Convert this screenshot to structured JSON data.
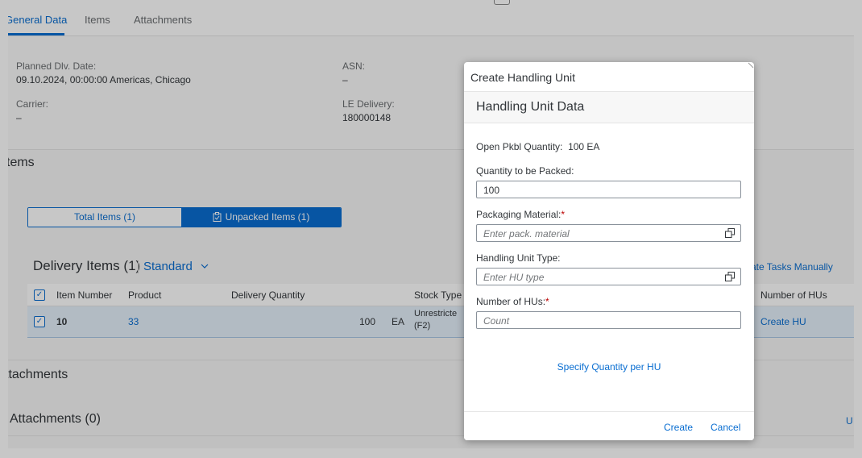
{
  "tabs": [
    "General Data",
    "Items",
    "Attachments"
  ],
  "general": {
    "planned_label": "Planned Dlv. Date:",
    "planned_value": "09.10.2024, 00:00:00 Americas, Chicago",
    "asn_label": "ASN:",
    "asn_value": "–",
    "carrier_label": "Carrier:",
    "carrier_value": "–",
    "le_label": "LE Delivery:",
    "le_value": "180000148"
  },
  "items_section": {
    "title": "tems",
    "seg_total": "Total Items (1)",
    "seg_unpacked": "Unpacked Items (1)",
    "table_title": "Delivery Items (1)",
    "variant": "Standard",
    "create_tasks": "ate Tasks Manually",
    "columns": [
      "Item Number",
      "Product",
      "Delivery Quantity",
      "Stock Type",
      "Number of HUs"
    ],
    "row": {
      "item": "10",
      "product": "33",
      "qty": "100",
      "uom": "EA",
      "stock1": "Unrestricte",
      "stock2": "(F2)",
      "action": "Create HU"
    }
  },
  "attachments_section": {
    "title": "ttachments",
    "sub_title": "Attachments (0)",
    "right_text": "U"
  },
  "dialog": {
    "title": "Create Handling Unit",
    "subtitle": "Handling Unit Data",
    "open_qty_label": "Open Pkbl Quantity:",
    "open_qty_value": "100 EA",
    "qty_label": "Quantity to be Packed:",
    "qty_value": "100",
    "pm_label": "Packaging Material:",
    "pm_placeholder": "Enter pack. material",
    "hut_label": "Handling Unit Type:",
    "hut_placeholder": "Enter HU type",
    "nhu_label": "Number of HUs:",
    "nhu_placeholder": "Count",
    "required_mark": "*",
    "specify_link": "Specify Quantity per HU",
    "create_btn": "Create",
    "cancel_btn": "Cancel"
  },
  "colors": {
    "brand_blue": "#0a6ed1",
    "required_red": "#bb0000",
    "row_selected": "#e5f0fa"
  },
  "icons": [
    "clipboard-icon",
    "chevron-down-icon",
    "value-help-icon",
    "checkbox-checked-icon"
  ]
}
